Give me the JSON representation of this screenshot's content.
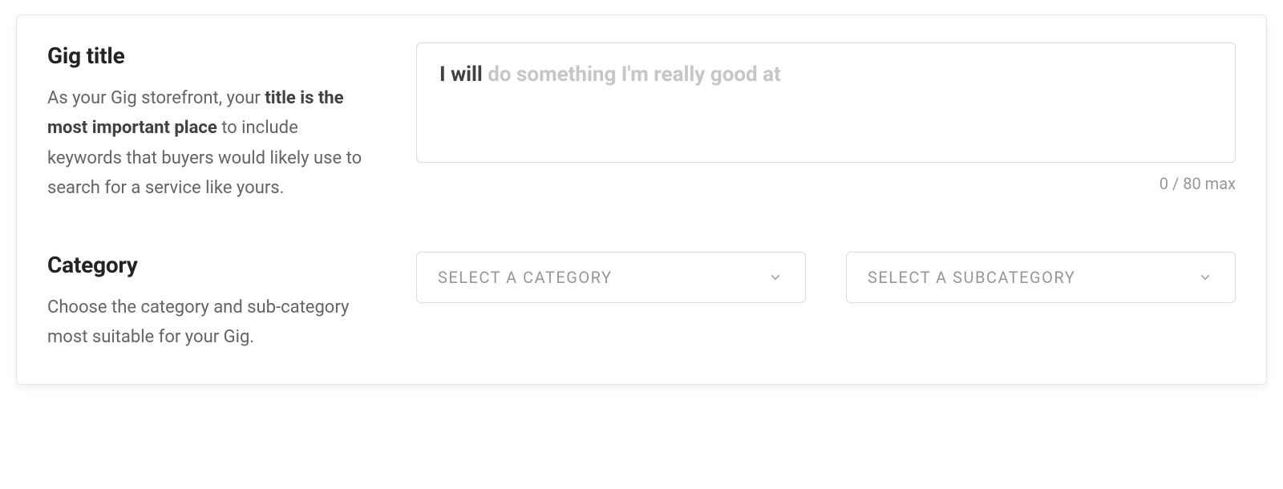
{
  "gig_title": {
    "heading": "Gig title",
    "help_pre": "As your Gig storefront, your ",
    "help_em": "title is the most important place",
    "help_post": " to include keywords that buyers would likely use to search for a service like yours.",
    "prefix": "I will",
    "placeholder": "do something I'm really good at",
    "value": "",
    "counter": "0 / 80 max"
  },
  "category": {
    "heading": "Category",
    "help": "Choose the category and sub-category most suitable for your Gig.",
    "category_select": {
      "label": "SELECT A CATEGORY"
    },
    "subcategory_select": {
      "label": "SELECT A SUBCATEGORY"
    }
  }
}
